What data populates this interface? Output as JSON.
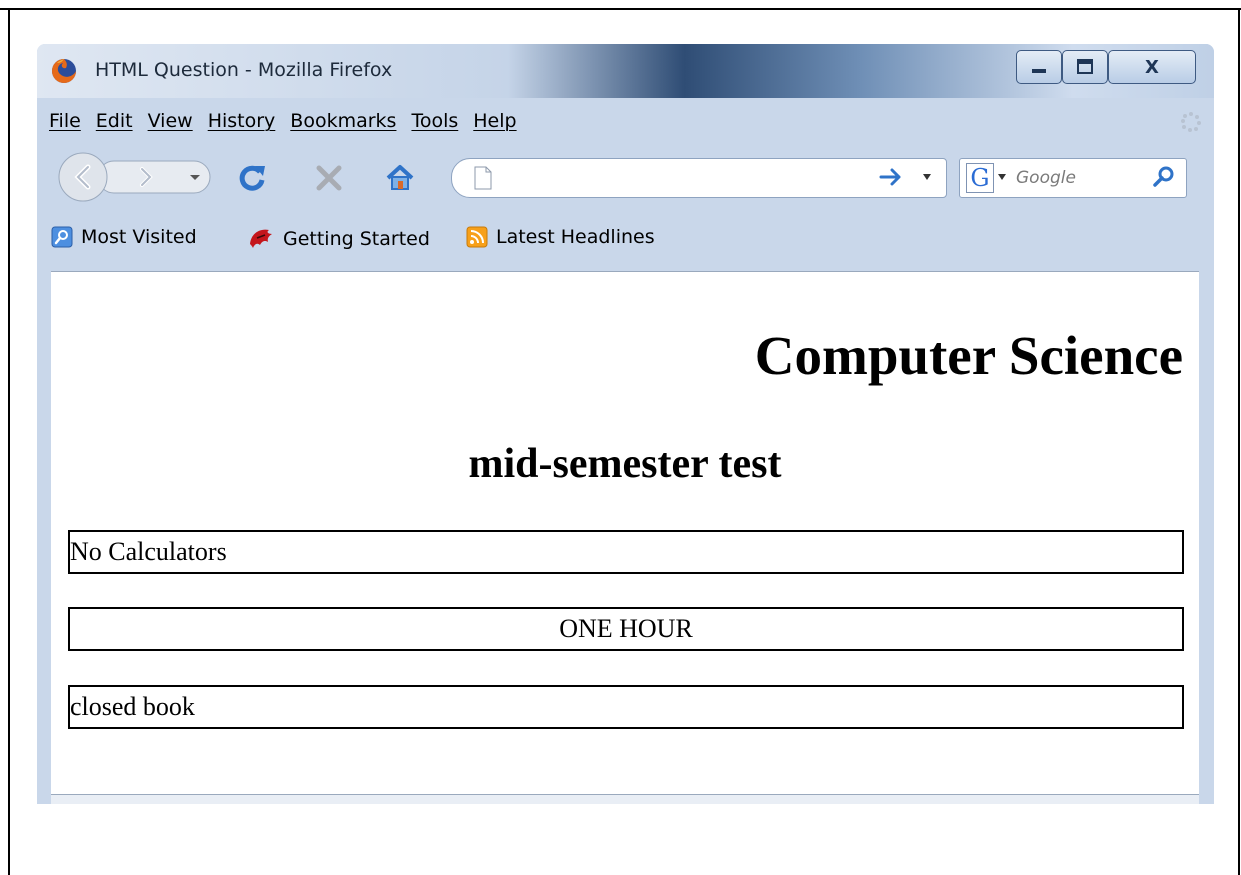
{
  "window": {
    "title": "HTML Question - Mozilla Firefox",
    "minimize_label": "—",
    "maximize_label": "☐",
    "close_label": "X"
  },
  "menu": {
    "items": [
      {
        "label": "File"
      },
      {
        "label": "Edit"
      },
      {
        "label": "View"
      },
      {
        "label": "History"
      },
      {
        "label": "Bookmarks"
      },
      {
        "label": "Tools"
      },
      {
        "label": "Help"
      }
    ]
  },
  "toolbar": {
    "url_value": "",
    "search_engine_letter": "G",
    "search_placeholder": "Google"
  },
  "bookmarks": {
    "items": [
      {
        "label": "Most Visited"
      },
      {
        "label": "Getting Started"
      },
      {
        "label": "Latest Headlines"
      }
    ]
  },
  "page": {
    "heading": "Computer Science",
    "subheading": "mid-semester test",
    "boxes": [
      {
        "text": "No Calculators",
        "align": "left"
      },
      {
        "text": "ONE HOUR",
        "align": "center"
      },
      {
        "text": "closed book",
        "align": "left"
      }
    ]
  },
  "colors": {
    "accent": "#2b6cd4",
    "titlebar_dark": "#2f4d75",
    "chrome": "#c9d7ea"
  }
}
